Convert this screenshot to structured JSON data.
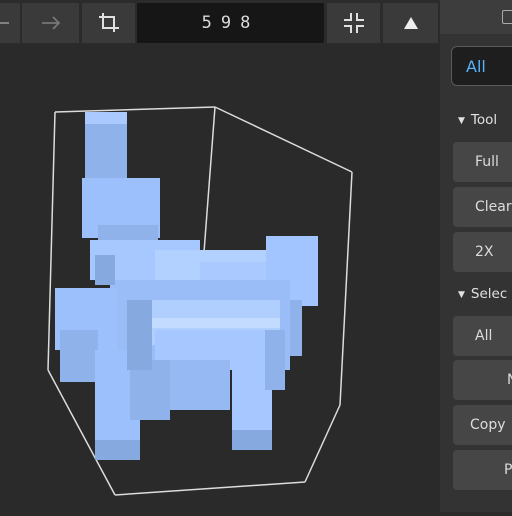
{
  "toolbar": {
    "back_icon": "arrow-left-icon",
    "forward_icon": "arrow-right-icon",
    "crop_icon": "crop-icon",
    "counter": "598",
    "collapse_icon": "collapse-icon",
    "up_icon": "triangle-up-icon"
  },
  "panel": {
    "header_icon": "panel-icon",
    "select_value": "All",
    "sections": [
      {
        "label": "Tool",
        "buttons": [
          "Full",
          "Clear",
          "2X"
        ]
      },
      {
        "label": "Selec",
        "buttons": [
          "All",
          "N",
          "Copy",
          "P"
        ]
      }
    ]
  },
  "colors": {
    "accent": "#56b3ff",
    "voxel": "#9ec3ff"
  }
}
